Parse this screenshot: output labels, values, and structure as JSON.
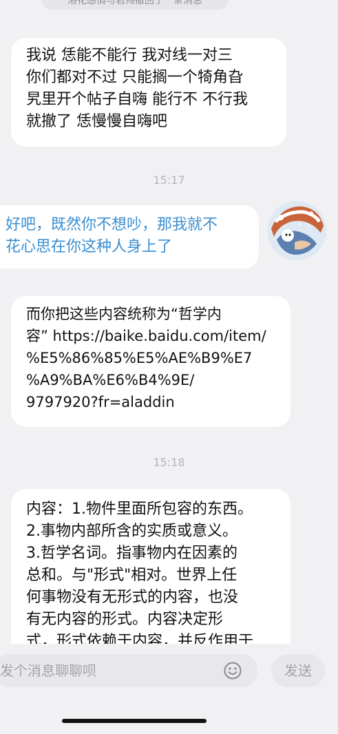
{
  "system_notice": "洛花感情与君殇撤回了一条消息",
  "messages": [
    {
      "side": "left",
      "lines": [
        "我说 恁能不能行 我对线一对三",
        "你们都对不过 只能搁一个犄角旮",
        "旯里开个帖子自嗨 能行不 不行我",
        "就撤了 恁慢慢自嗨吧"
      ]
    },
    {
      "time": "15:17"
    },
    {
      "side": "right",
      "lines": [
        "好吧，既然你不想吵，那我就不",
        "花心思在你这种人身上了"
      ]
    },
    {
      "side": "left",
      "lines": [
        "而你把这些内容统称为“哲学内",
        "容” https://baike.baidu.com/item/",
        "%E5%86%85%E5%AE%B9%E7",
        "%A9%BA%E6%B4%9E/",
        "9797920?fr=aladdin"
      ]
    },
    {
      "time": "15:18"
    },
    {
      "side": "left",
      "lines": [
        "内容：1.物件里面所包容的东西。",
        "2.事物内部所含的实质或意义。",
        "3.哲学名词。指事物内在因素的",
        "总和。与\"形式\"相对。世界上任",
        "何事物没有无形式的内容，也没",
        "有无内容的形式。内容决定形",
        "式，形式依赖于内容，并反作用于"
      ]
    }
  ],
  "input": {
    "placeholder": "发个消息聊聊呗",
    "emoji_icon": "smiley-icon",
    "send_label": "发送"
  },
  "colors": {
    "background": "#f1f1f4",
    "bubble": "#ffffff",
    "self_text": "#3a8ed0",
    "timestamp": "#b4b4ba"
  }
}
